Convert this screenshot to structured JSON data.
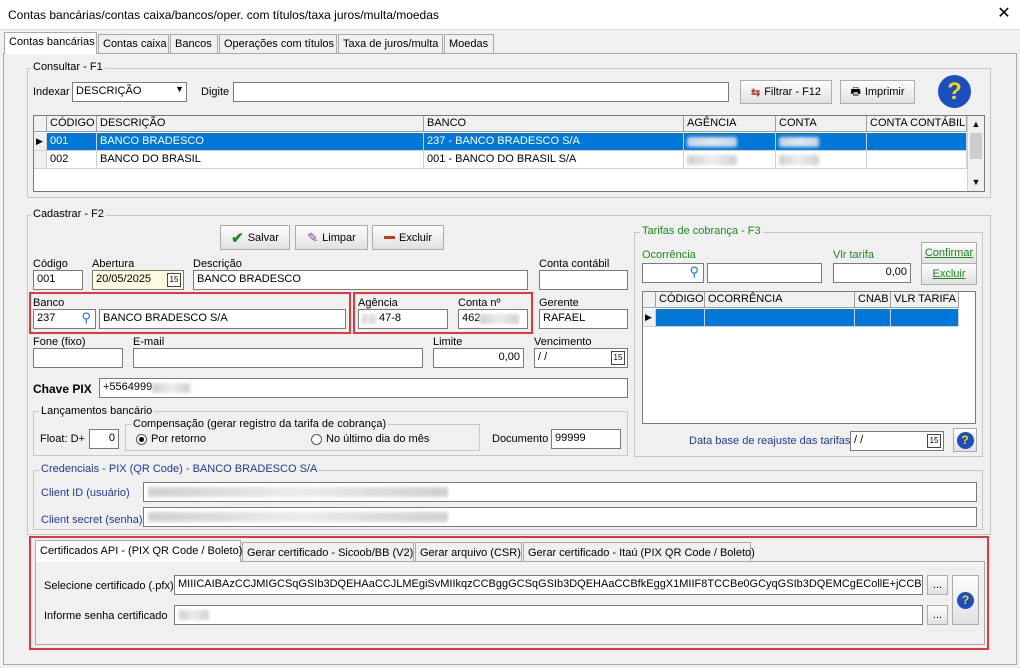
{
  "window": {
    "title": "Contas bancárias/contas caixa/bancos/oper. com títulos/taxa juros/multa/moedas",
    "close": "✕"
  },
  "tabs": [
    "Contas bancárias",
    "Contas caixa",
    "Bancos",
    "Operações com títulos",
    "Taxa de juros/multa",
    "Moedas"
  ],
  "consultar": {
    "group_label": "Consultar - F1",
    "indexar_label": "Indexar",
    "indexar_value": "DESCRIÇÃO",
    "digite_label": "Digite",
    "digite_value": "",
    "filtrar_label": "Filtrar - F12",
    "imprimir_label": "Imprimir",
    "columns": [
      "CÓDIGO",
      "DESCRIÇÃO",
      "BANCO",
      "AGÊNCIA",
      "CONTA",
      "CONTA CONTÁBIL"
    ],
    "rows": [
      {
        "codigo": "001",
        "descricao": "BANCO BRADESCO",
        "banco": "237 - BANCO BRADESCO S/A"
      },
      {
        "codigo": "002",
        "descricao": "BANCO DO BRASIL",
        "banco": "001 - BANCO DO BRASIL S/A"
      }
    ]
  },
  "cadastrar": {
    "group_label": "Cadastrar - F2",
    "salvar": "Salvar",
    "limpar": "Limpar",
    "excluir": "Excluir",
    "codigo_label": "Código",
    "codigo": "001",
    "abertura_label": "Abertura",
    "abertura": "20/05/2025",
    "descricao_label": "Descrição",
    "descricao": "BANCO BRADESCO",
    "conta_contabil_label": "Conta contábil",
    "conta_contabil": "",
    "banco_label": "Banco",
    "banco_codigo": "237",
    "banco_nome": "BANCO BRADESCO S/A",
    "agencia_label": "Agência",
    "agencia": "47-8",
    "conta_label": "Conta nº",
    "conta": "462",
    "gerente_label": "Gerente",
    "gerente": "RAFAEL",
    "fone_label": "Fone (fixo)",
    "fone": "",
    "email_label": "E-mail",
    "email": "",
    "limite_label": "Limite",
    "limite": "0,00",
    "vencimento_label": "Vencimento",
    "vencimento": " /  /",
    "pix_label": "Chave PIX",
    "pix": "+5564999",
    "lanc_label": "Lançamentos bancário",
    "float_label": "Float: D+",
    "float": "0",
    "comp_label": "Compensação (gerar registro da tarifa de cobrança)",
    "radio1": "Por retorno",
    "radio2": "No último dia do mês",
    "documento_label": "Documento",
    "documento": "99999"
  },
  "tarifas": {
    "group_label": "Tarifas de cobrança - F3",
    "ocorrencia_label": "Ocorrência",
    "vlr_label": "Vlr tarifa",
    "vlr": "0,00",
    "confirmar": "Confirmar",
    "excluir": "Excluir",
    "columns": [
      "CÓDIGO",
      "OCORRÊNCIA",
      "CNAB",
      "VLR TARIFA"
    ],
    "data_base_label": "Data base de reajuste das tarifas",
    "data_base": " /  /"
  },
  "credenciais": {
    "group_label": "Credenciais - PIX (QR Code) - BANCO BRADESCO S/A",
    "client_id_label": "Client ID (usuário)",
    "client_secret_label": "Client secret (senha)"
  },
  "cert": {
    "tabs": [
      "Certificados API - (PIX QR Code / Boleto)",
      "Gerar certificado - Sicoob/BB (V2)",
      "Gerar arquivo (CSR)",
      "Gerar certificado - Itaú (PIX QR Code / Boleto)"
    ],
    "selecione_label": "Selecione certificado (.pfx)",
    "certificado": "MIIICAIBAzCCJMIGCSqGSIb3DQEHAaCCJLMEgiSvMIIkqzCCBggGCSqGSIb3DQEHAaCCBfkEggX1MIIF8TCCBe0GCyqGSIb3DQEMCgECollE+jCCBPYwKA",
    "senha_label": "Informe senha certificado",
    "dots": "...",
    "help": "?"
  }
}
